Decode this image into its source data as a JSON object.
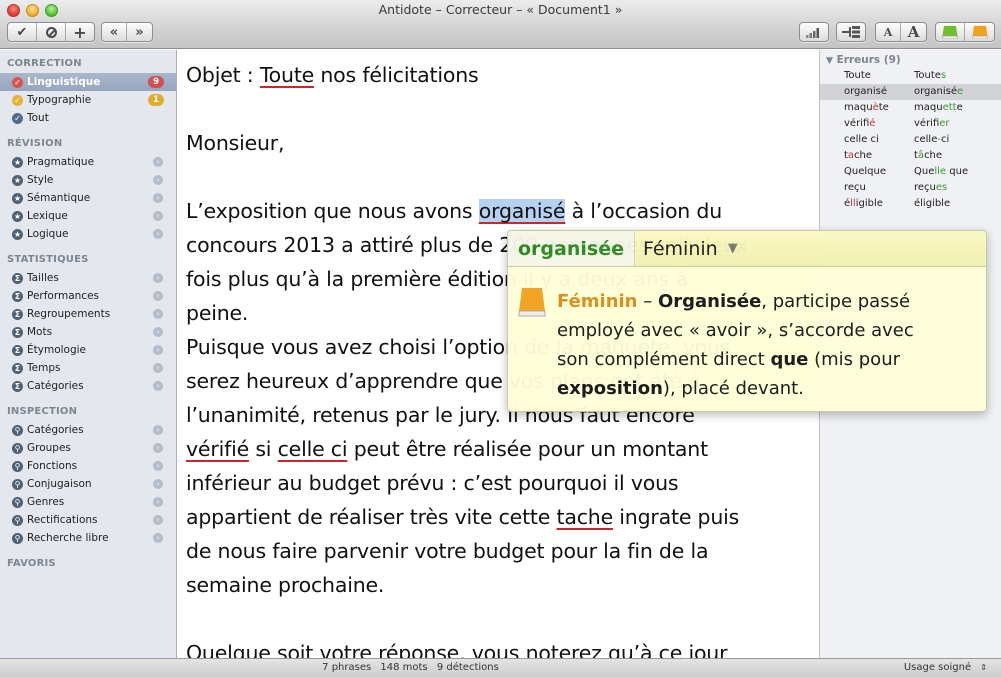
{
  "window": {
    "title": "Antidote – Correcteur – « Document1 »"
  },
  "toolbar": {
    "left_group1": [
      {
        "name": "accept-icon",
        "glyph": "✔"
      },
      {
        "name": "ignore-icon",
        "glyph": "⊘"
      },
      {
        "name": "add-icon",
        "glyph": "+"
      }
    ],
    "left_group2": [
      {
        "name": "previous-icon",
        "glyph": "«"
      },
      {
        "name": "next-icon",
        "glyph": "»"
      }
    ],
    "right_text_small": "A",
    "right_text_large": "A",
    "accent_green": "#6fbf2a",
    "accent_orange": "#f2a21c"
  },
  "sidebar": {
    "sections": [
      {
        "title": "CORRECTION",
        "items": [
          {
            "label": "Linguistique",
            "icon": "check-red",
            "badge": "9",
            "selected": true
          },
          {
            "label": "Typographie",
            "icon": "check-yellow",
            "badge": "1"
          },
          {
            "label": "Tout",
            "icon": "check-blue"
          }
        ]
      },
      {
        "title": "RÉVISION",
        "items": [
          {
            "label": "Pragmatique"
          },
          {
            "label": "Style"
          },
          {
            "label": "Sémantique"
          },
          {
            "label": "Lexique"
          },
          {
            "label": "Logique"
          }
        ]
      },
      {
        "title": "STATISTIQUES",
        "items": [
          {
            "label": "Tailles"
          },
          {
            "label": "Performances"
          },
          {
            "label": "Regroupements"
          },
          {
            "label": "Mots"
          },
          {
            "label": "Étymologie"
          },
          {
            "label": "Temps"
          },
          {
            "label": "Catégories"
          }
        ]
      },
      {
        "title": "INSPECTION",
        "items": [
          {
            "label": "Catégories"
          },
          {
            "label": "Groupes"
          },
          {
            "label": "Fonctions"
          },
          {
            "label": "Conjugaison"
          },
          {
            "label": "Genres"
          },
          {
            "label": "Rectifications"
          },
          {
            "label": "Recherche libre"
          }
        ]
      },
      {
        "title": "FAVORIS",
        "items": []
      }
    ]
  },
  "document": {
    "lines": [
      [
        {
          "t": "Objet : "
        },
        {
          "t": "Toute",
          "err": true
        },
        {
          "t": " nos félicitations"
        }
      ],
      [],
      [
        {
          "t": "Monsieur,"
        }
      ],
      [],
      [
        {
          "t": "L’exposition que nous avons "
        },
        {
          "t": "organisé",
          "err": true,
          "sel": true
        },
        {
          "t": " à l’occasion du"
        }
      ],
      [
        {
          "t": "concours 2013 a attiré plus de 200 personnes soit deux"
        }
      ],
      [
        {
          "t": "fois plus qu’à la première édition il y a deux ans à"
        }
      ],
      [
        {
          "t": "peine."
        }
      ],
      [
        {
          "t": "Puisque vous avez choisi l’option de la maquète, vous"
        }
      ],
      [
        {
          "t": "serez heureux d’apprendre que vos plans ont été à"
        }
      ],
      [
        {
          "t": "l’unanimité, retenus par le jury. Il nous faut encore"
        }
      ],
      [
        {
          "t": "vérifié",
          "err": true
        },
        {
          "t": " si "
        },
        {
          "t": "celle ci",
          "err": true
        },
        {
          "t": " peut être réalisée pour un montant"
        }
      ],
      [
        {
          "t": "inférieur au budget prévu : c’est pourquoi il vous"
        }
      ],
      [
        {
          "t": "appartient de réaliser très vite cette "
        },
        {
          "t": "tache",
          "err": true
        },
        {
          "t": " ingrate puis"
        }
      ],
      [
        {
          "t": "de nous faire parvenir votre budget pour la fin de la"
        }
      ],
      [
        {
          "t": "semaine prochaine."
        }
      ],
      [],
      [
        {
          "t": "Quelque",
          "err": true
        },
        {
          "t": " soit votre réponse, vous noterez qu’à ce jour"
        }
      ]
    ]
  },
  "errors_panel": {
    "title": "Erreurs (9)",
    "rows": [
      {
        "orig": [
          {
            "t": "Toute"
          }
        ],
        "fix": [
          {
            "t": "Toute"
          },
          {
            "t": "s",
            "c": "g"
          }
        ]
      },
      {
        "orig": [
          {
            "t": "organisé"
          }
        ],
        "fix": [
          {
            "t": "organisé"
          },
          {
            "t": "e",
            "c": "g"
          }
        ],
        "selected": true
      },
      {
        "orig": [
          {
            "t": "maqu"
          },
          {
            "t": "è",
            "c": "r"
          },
          {
            "t": "te"
          }
        ],
        "fix": [
          {
            "t": "maqu"
          },
          {
            "t": "ett",
            "c": "g"
          },
          {
            "t": "e"
          }
        ]
      },
      {
        "orig": [
          {
            "t": "vérifi"
          },
          {
            "t": "é",
            "c": "r"
          }
        ],
        "fix": [
          {
            "t": "vérifi"
          },
          {
            "t": "er",
            "c": "g"
          }
        ]
      },
      {
        "orig": [
          {
            "t": "celle ci"
          }
        ],
        "fix": [
          {
            "t": "celle"
          },
          {
            "t": "-",
            "c": "g"
          },
          {
            "t": "ci"
          }
        ]
      },
      {
        "orig": [
          {
            "t": "t"
          },
          {
            "t": "a",
            "c": "r"
          },
          {
            "t": "che"
          }
        ],
        "fix": [
          {
            "t": "t"
          },
          {
            "t": "â",
            "c": "g"
          },
          {
            "t": "che"
          }
        ]
      },
      {
        "orig": [
          {
            "t": "Quelque"
          }
        ],
        "fix": [
          {
            "t": "Que"
          },
          {
            "t": "lle",
            "c": "g"
          },
          {
            "t": " que"
          }
        ]
      },
      {
        "orig": [
          {
            "t": "reçu"
          }
        ],
        "fix": [
          {
            "t": "reçu"
          },
          {
            "t": "es",
            "c": "g"
          }
        ]
      },
      {
        "orig": [
          {
            "t": "é"
          },
          {
            "t": "ll",
            "c": "r"
          },
          {
            "t": "igible"
          }
        ],
        "fix": [
          {
            "t": "éligible"
          }
        ]
      }
    ]
  },
  "popover": {
    "suggestion": "organisée",
    "category": "Féminin",
    "body_lines": [
      [
        {
          "t": "Féminin",
          "k": true
        },
        {
          "t": " – "
        },
        {
          "t": "Organisée",
          "b": true
        },
        {
          "t": ", participe passé"
        }
      ],
      [
        {
          "t": "employé avec « avoir », s’accorde avec"
        }
      ],
      [
        {
          "t": "son complément direct "
        },
        {
          "t": "que",
          "b": true
        },
        {
          "t": " (mis pour"
        }
      ],
      [
        {
          "t": "exposition",
          "b": true
        },
        {
          "t": "), placé devant."
        }
      ]
    ]
  },
  "statusbar": {
    "phrases": "7 phrases",
    "mots": "148 mots",
    "detections": "9 détections",
    "usage": "Usage soigné"
  }
}
